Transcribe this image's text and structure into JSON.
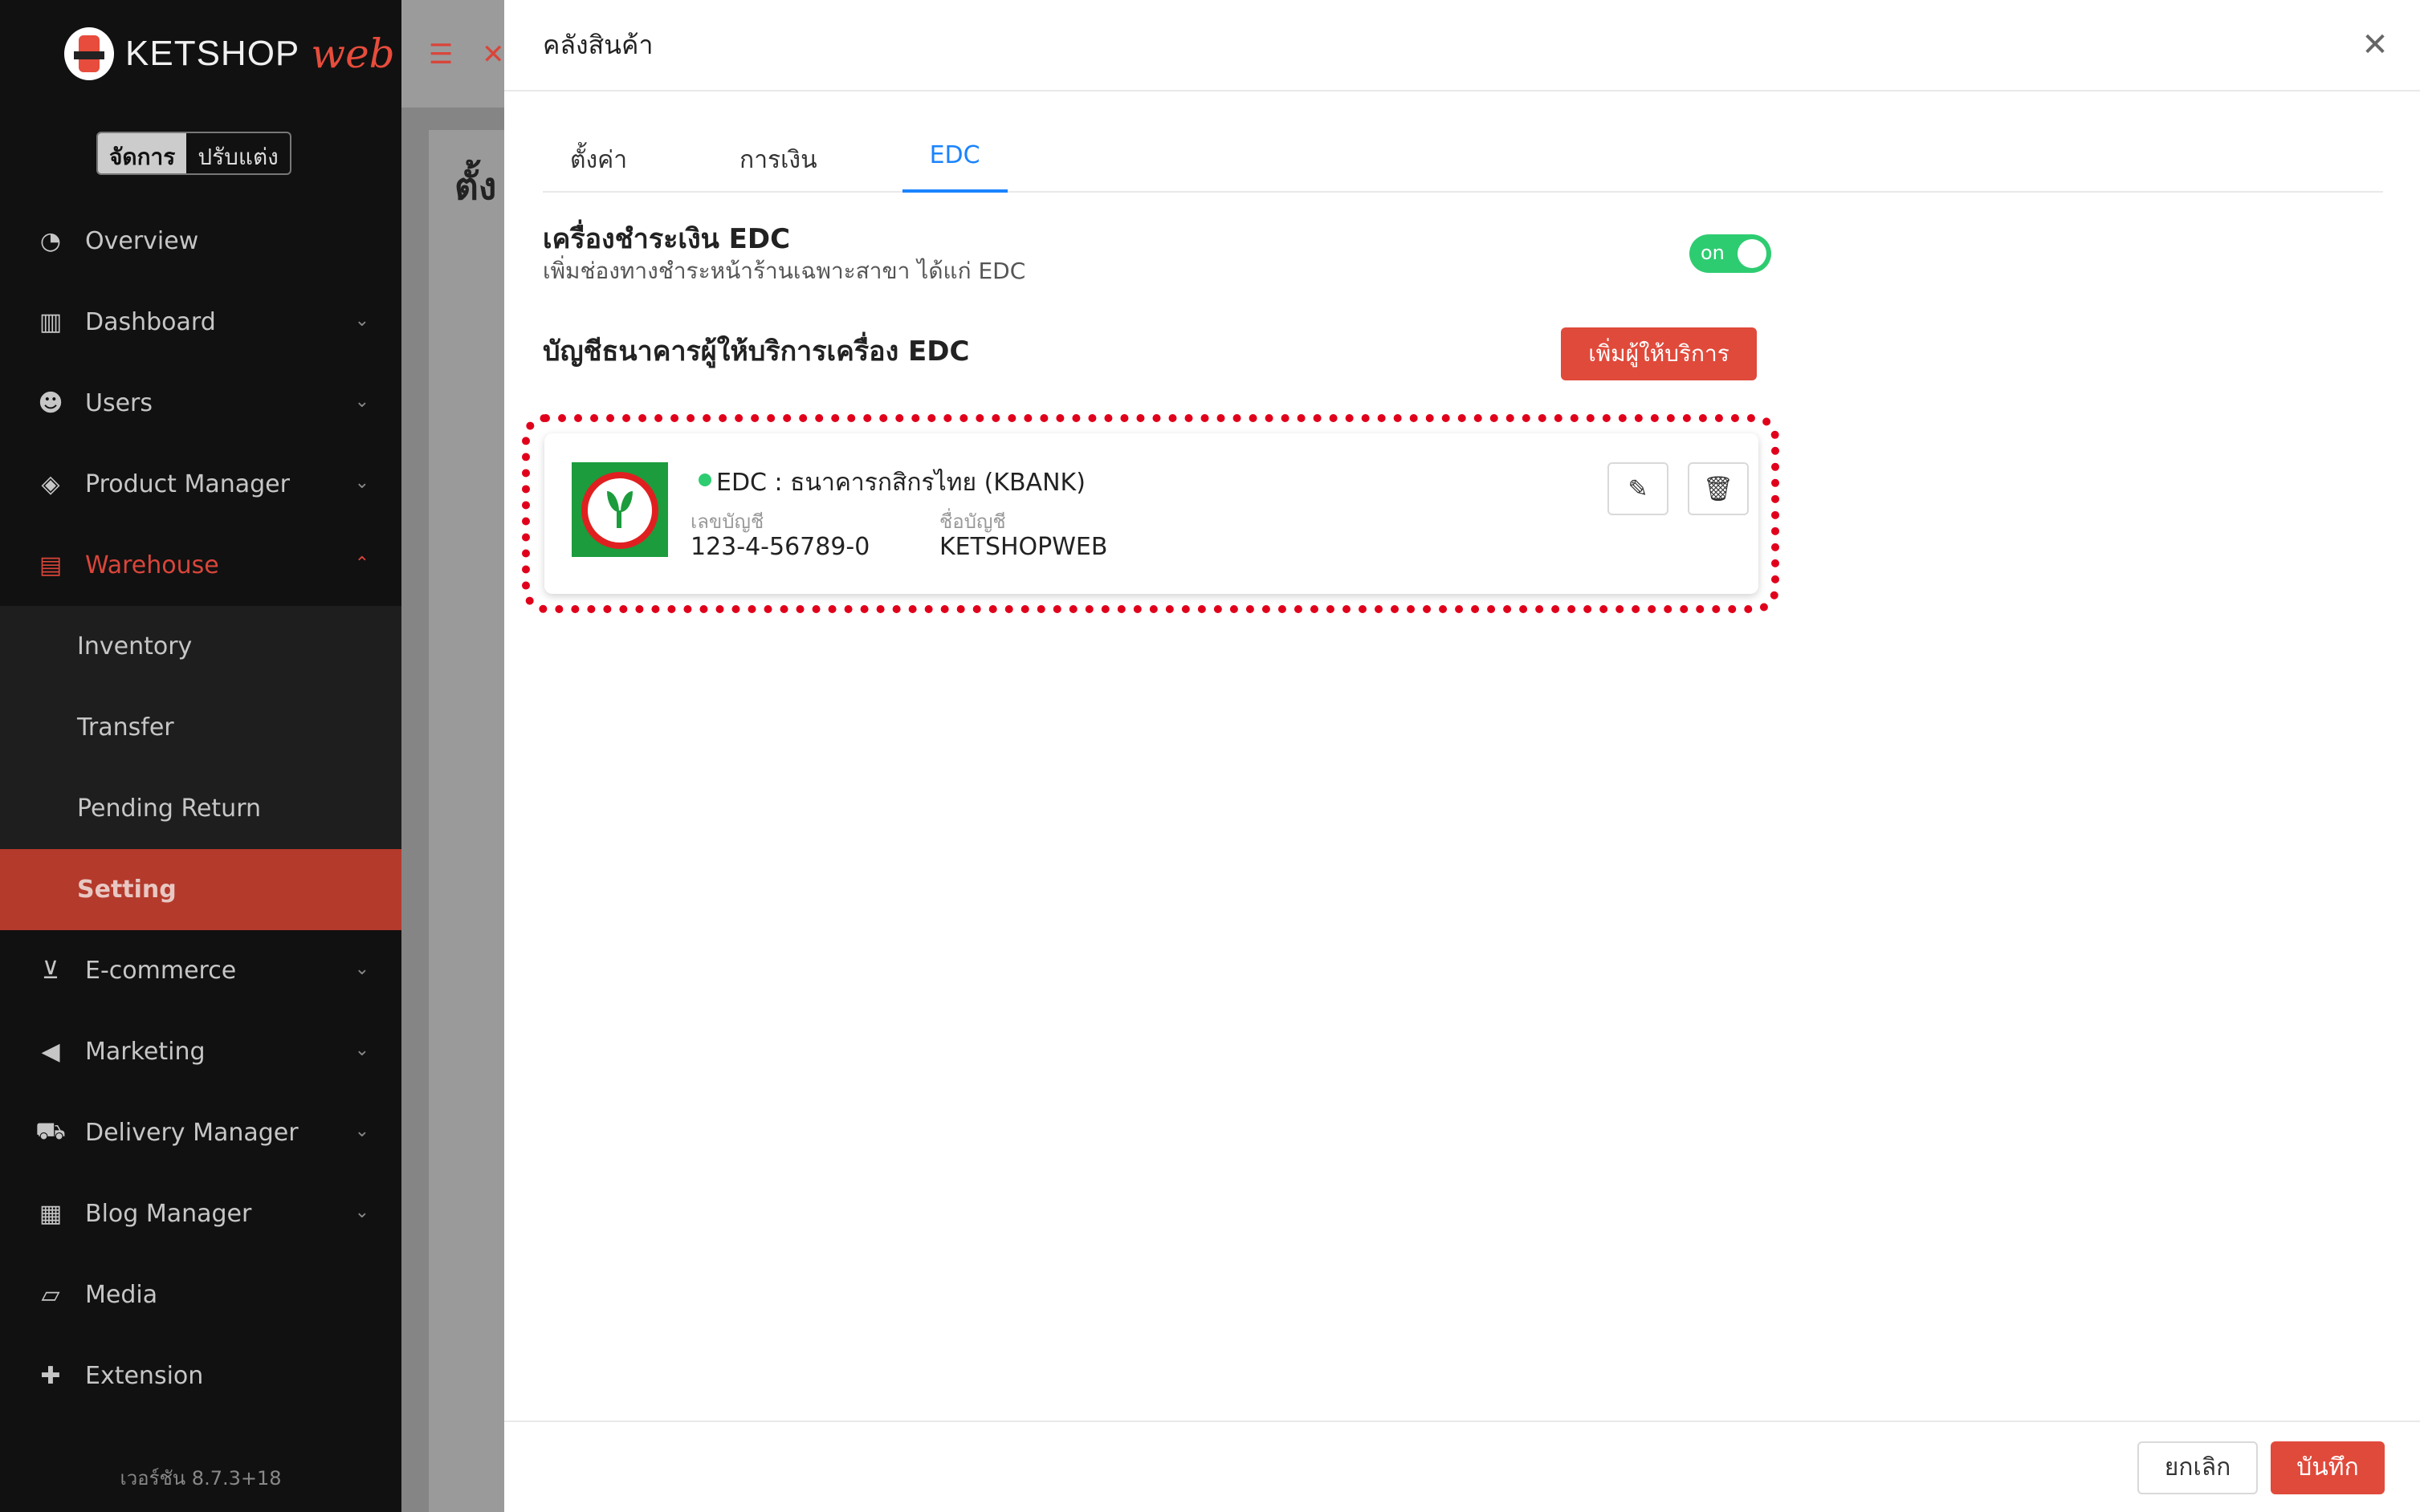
{
  "app": {
    "brand": "KETSHOP",
    "brand_suffix": "web",
    "version": "เวอร์ชัน 8.7.3+18"
  },
  "mode_switch": [
    {
      "label": "จัดการ",
      "active": true
    },
    {
      "label": "ปรับแต่ง",
      "active": false
    }
  ],
  "sidebar": {
    "items": [
      {
        "label": "Overview",
        "icon": "pie-chart-icon",
        "has_chevron": false
      },
      {
        "label": "Dashboard",
        "icon": "bar-chart-icon",
        "has_chevron": true
      },
      {
        "label": "Users",
        "icon": "users-icon",
        "has_chevron": true
      },
      {
        "label": "Product Manager",
        "icon": "tags-icon",
        "has_chevron": true
      },
      {
        "label": "Warehouse",
        "icon": "warehouse-icon",
        "has_chevron": true,
        "active": true
      }
    ],
    "warehouse_sub": [
      {
        "label": "Inventory"
      },
      {
        "label": "Transfer"
      },
      {
        "label": "Pending Return"
      },
      {
        "label": "Setting",
        "selected": true
      }
    ],
    "items_after": [
      {
        "label": "E-commerce",
        "icon": "cart-icon",
        "has_chevron": true
      },
      {
        "label": "Marketing",
        "icon": "megaphone-icon",
        "has_chevron": true
      },
      {
        "label": "Delivery Manager",
        "icon": "truck-icon",
        "has_chevron": true
      },
      {
        "label": "Blog Manager",
        "icon": "newspaper-icon",
        "has_chevron": true
      },
      {
        "label": "Media",
        "icon": "folder-icon",
        "has_chevron": false
      },
      {
        "label": "Extension",
        "icon": "puzzle-icon",
        "has_chevron": false
      }
    ]
  },
  "background": {
    "title_fragment": "ตั้ง"
  },
  "drawer": {
    "title": "คลังสินค้า",
    "tabs": [
      {
        "label": "ตั้งค่า"
      },
      {
        "label": "การเงิน"
      },
      {
        "label": "EDC",
        "active": true
      }
    ],
    "edc_section": {
      "title": "เครื่องชำระเงิน EDC",
      "description": "เพิ่มช่องทางชำระหน้าร้านเฉพาะสาขา ได้แก่ EDC",
      "toggle_label": "on",
      "toggle_on": true
    },
    "providers_section": {
      "title": "บัญชีธนาคารผู้ให้บริการเครื่อง EDC",
      "add_button": "เพิ่มผู้ให้บริการ"
    },
    "account": {
      "name": "EDC : ธนาคารกสิกรไทย (KBANK)",
      "account_no_label": "เลขบัญชี",
      "account_no": "123-4-56789-0",
      "account_holder_label": "ชื่อบัญชี",
      "account_holder": "KETSHOPWEB",
      "status_color": "#2ecc71"
    },
    "footer": {
      "cancel_label": "ยกเลิก",
      "save_label": "บันทึก"
    }
  },
  "colors": {
    "accent": "#e04a3b",
    "tab_active": "#1a83ff",
    "toggle_on": "#2ecc71",
    "sidebar_bg": "#111111"
  }
}
